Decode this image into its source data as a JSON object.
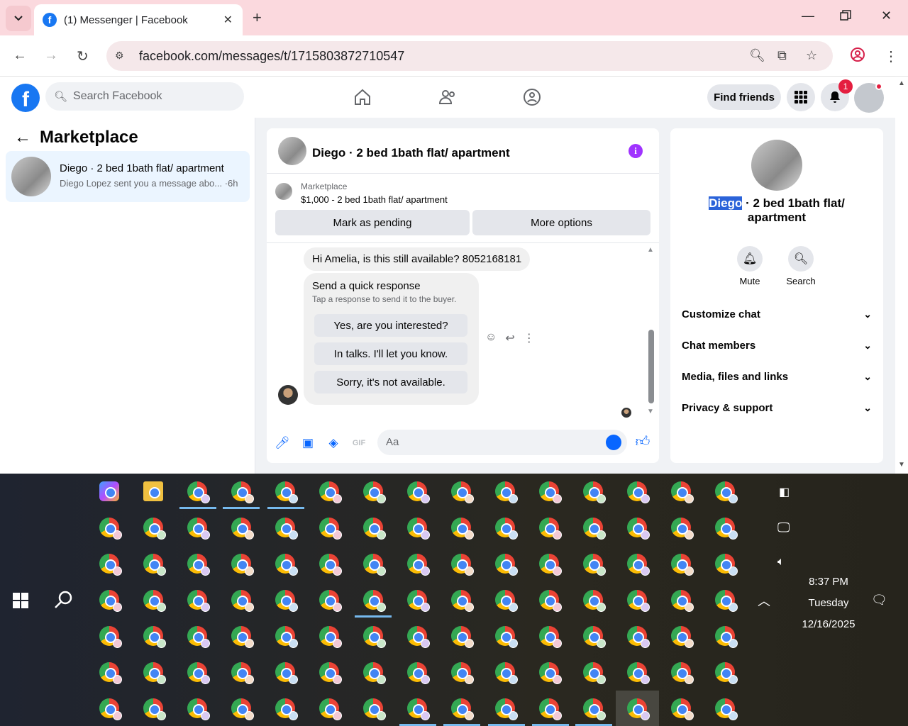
{
  "browser": {
    "tab_title": "(1) Messenger | Facebook",
    "tab_favicon": "f",
    "url": "facebook.com/messages/t/1715803872710547"
  },
  "fb": {
    "logo": "f",
    "search_placeholder": "Search Facebook",
    "find_friends": "Find friends",
    "notif_count": "1"
  },
  "left": {
    "heading": "Marketplace",
    "conv_name": "Diego · 2 bed 1bath flat/ apartment",
    "conv_snippet": "Diego Lopez sent you a message abo... ·6h"
  },
  "chat": {
    "title": "Diego · 2 bed 1bath flat/ apartment",
    "info": "i",
    "marketplace_label": "Marketplace",
    "listing": "$1,000 - 2 bed 1bath flat/ apartment",
    "btn_pending": "Mark as pending",
    "btn_more": "More options",
    "message": "Hi Amelia, is this still available? 8052168181",
    "qr_title": "Send a quick response",
    "qr_sub": "Tap a response to send it to the buyer.",
    "qr_opts": [
      "Yes, are you interested?",
      "In talks. I'll let you know.",
      "Sorry, it's not available."
    ],
    "composer_placeholder": "Aa"
  },
  "info_panel": {
    "name_highlight": "Diego",
    "name_rest": " · 2 bed 1bath flat/ apartment",
    "mute": "Mute",
    "search": "Search",
    "rows": [
      "Customize chat",
      "Chat members",
      "Media, files and links",
      "Privacy & support"
    ]
  },
  "taskbar": {
    "time": "8:37 PM",
    "day": "Tuesday",
    "date": "12/16/2025"
  },
  "colors": {
    "fb_blue": "#1877f2",
    "messenger_blue": "#0866ff",
    "tabbar_pink": "#fbd9de",
    "selection": "#2b63d9"
  }
}
